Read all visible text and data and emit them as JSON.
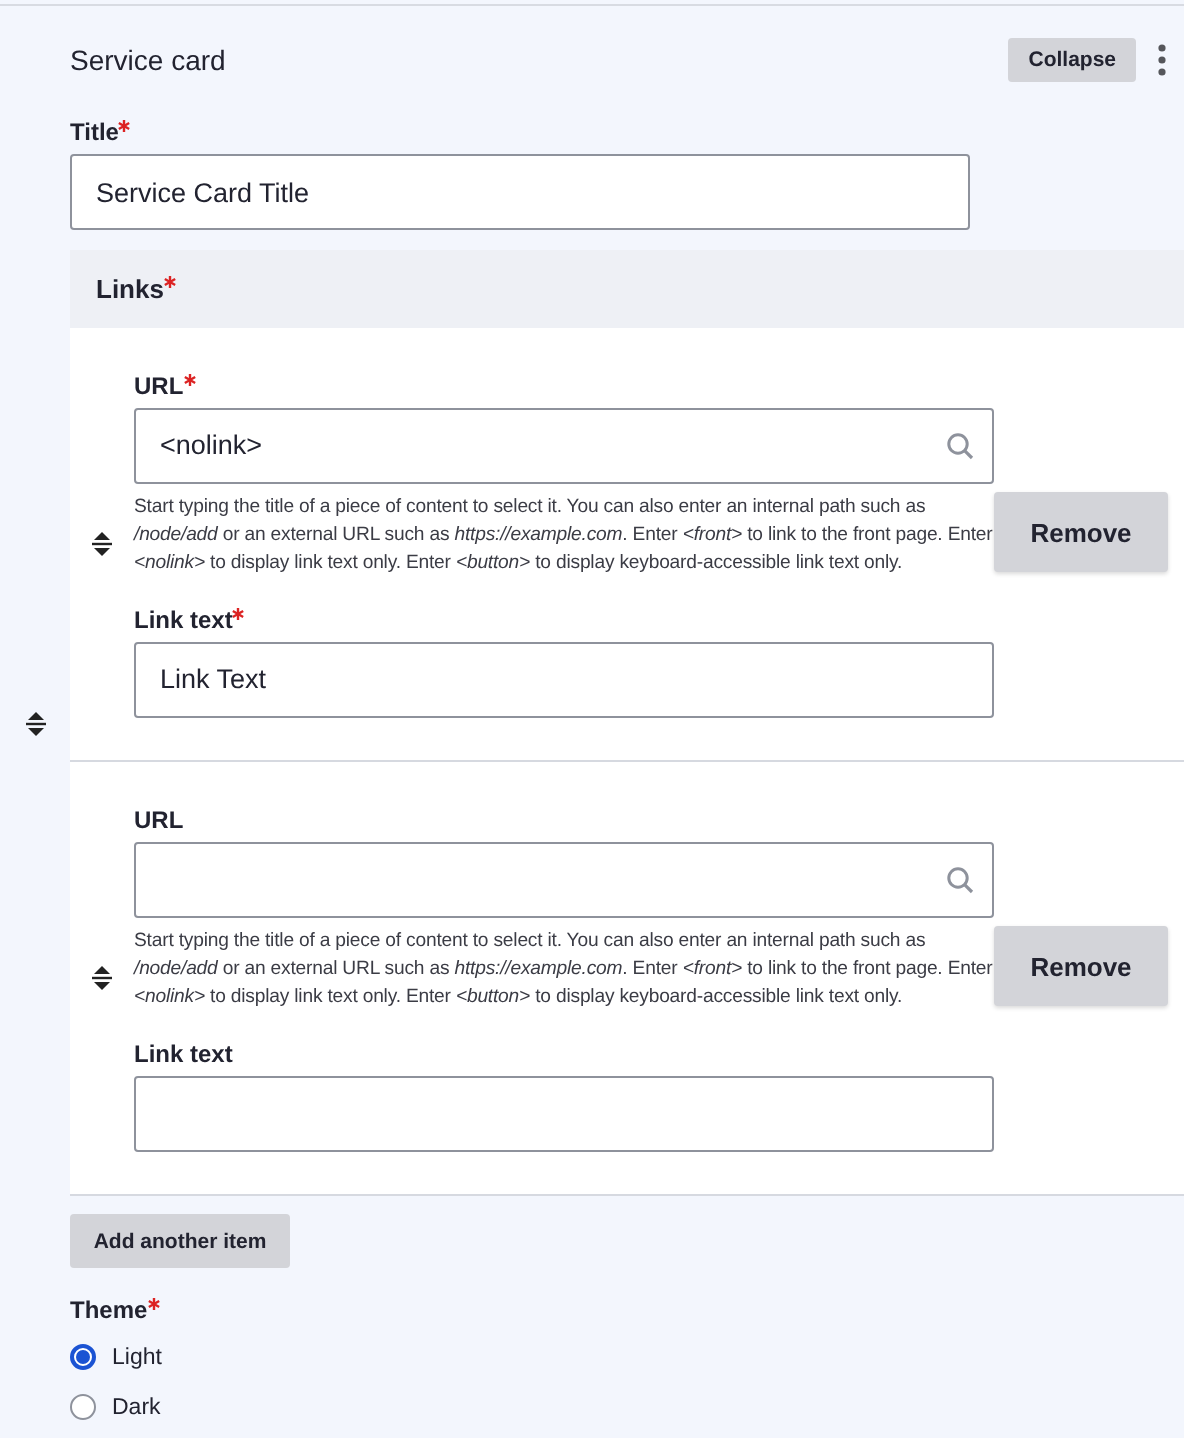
{
  "card": {
    "title": "Service card",
    "collapse_button": "Collapse"
  },
  "title_field": {
    "label": "Title",
    "required": true,
    "value": "Service Card Title"
  },
  "links": {
    "label": "Links",
    "required": true,
    "items": [
      {
        "url_label": "URL",
        "url_required": true,
        "url_value": "<nolink>",
        "description": "Start typing the title of a piece of content to select it. You can also enter an internal path such as */node/add* or an external URL such as *https://example.com*. Enter *<front>* to link to the front page. Enter *<nolink>* to display link text only. Enter *<button>* to display keyboard-accessible link text only.",
        "text_label": "Link text",
        "text_required": true,
        "text_value": "Link Text",
        "remove_button": "Remove"
      },
      {
        "url_label": "URL",
        "url_required": false,
        "description": "Start typing the title of a piece of content to select it. You can also enter an internal path such as */node/add* or an external URL such as *https://example.com*. Enter *<front>* to link to the front page. Enter *<nolink>* to display link text only. Enter *<button>* to display keyboard-accessible link text only.",
        "text_label": "Link text",
        "text_required": false,
        "remove_button": "Remove"
      }
    ],
    "add_button": "Add another item"
  },
  "theme": {
    "label": "Theme",
    "required": true,
    "options": [
      {
        "label": "Light",
        "selected": true
      },
      {
        "label": "Dark",
        "selected": false
      }
    ]
  }
}
